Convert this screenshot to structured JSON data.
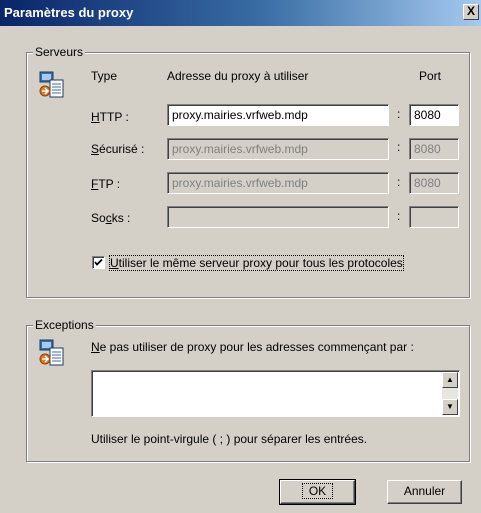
{
  "window": {
    "title": "Paramètres du proxy",
    "close_label": "X"
  },
  "servers": {
    "group_label": "Serveurs",
    "col_type": "Type",
    "col_address": "Adresse du proxy à utiliser",
    "col_port": "Port",
    "rows": [
      {
        "label_accel": "H",
        "label_rest": "TTP :",
        "address": "proxy.mairies.vrfweb.mdp",
        "port": "8080",
        "enabled": true
      },
      {
        "label_accel": "S",
        "label_rest": "écurisé :",
        "address": "proxy.mairies.vrfweb.mdp",
        "port": "8080",
        "enabled": false
      },
      {
        "label_accel": "F",
        "label_rest": "TP :",
        "address": "proxy.mairies.vrfweb.mdp",
        "port": "8080",
        "enabled": false
      },
      {
        "label_pre": "So",
        "label_accel": "c",
        "label_rest": "ks :",
        "address": "",
        "port": "",
        "enabled": false
      }
    ],
    "colon": ":",
    "same_proxy": {
      "accel": "U",
      "rest": "tiliser le même serveur proxy pour tous les protocoles",
      "checked": true
    }
  },
  "exceptions": {
    "group_label": "Exceptions",
    "desc_accel": "N",
    "desc_rest": "e pas utiliser de proxy pour les adresses commençant par :",
    "value": "",
    "hint": "Utiliser le point-virgule ( ; ) pour séparer les entrées."
  },
  "buttons": {
    "ok": "OK",
    "cancel": "Annuler"
  },
  "icons": {
    "servers": "proxy-settings-icon",
    "exceptions": "proxy-exceptions-icon"
  }
}
